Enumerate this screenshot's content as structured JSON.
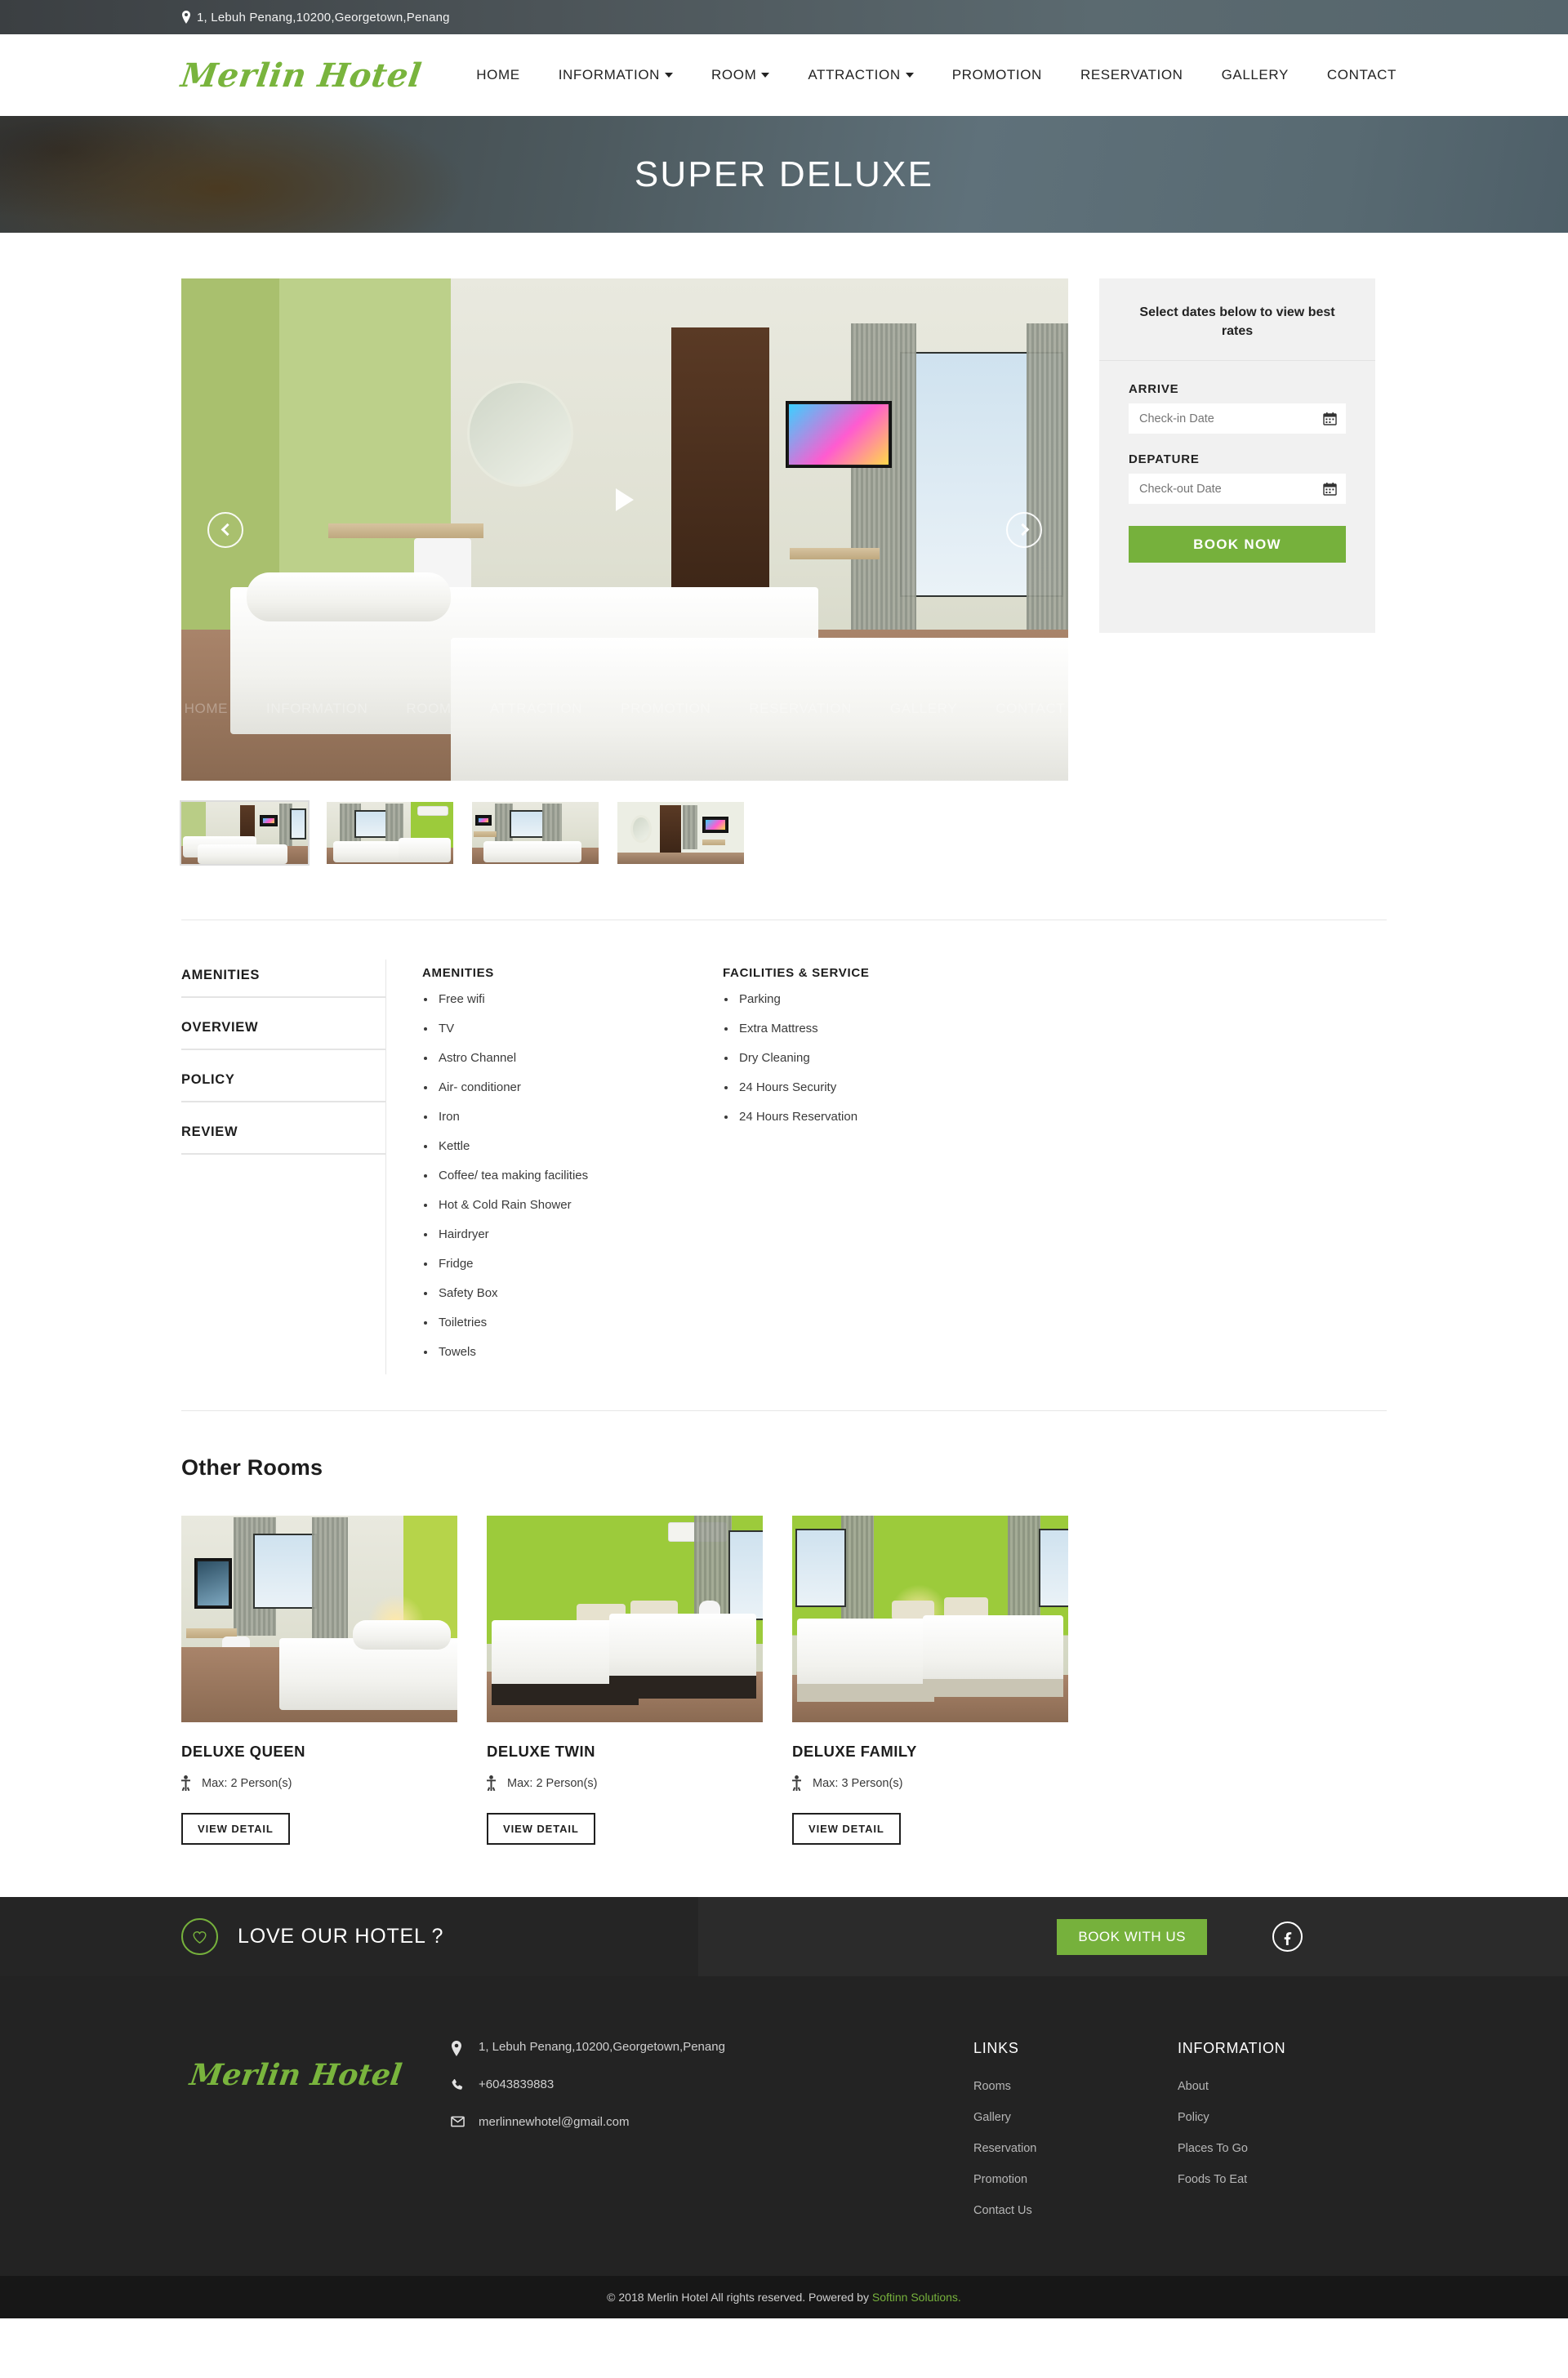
{
  "topbar": {
    "address": "1, Lebuh Penang,10200,Georgetown,Penang",
    "pin_icon": "map-pin-icon"
  },
  "brand": {
    "name": "Merlin Hotel"
  },
  "nav": {
    "items": [
      {
        "label": "HOME",
        "caret": false
      },
      {
        "label": "INFORMATION",
        "caret": true
      },
      {
        "label": "ROOM",
        "caret": true
      },
      {
        "label": "ATTRACTION",
        "caret": true
      },
      {
        "label": "PROMOTION",
        "caret": false
      },
      {
        "label": "RESERVATION",
        "caret": false
      },
      {
        "label": "GALLERY",
        "caret": false
      },
      {
        "label": "CONTACT",
        "caret": false
      }
    ]
  },
  "hero": {
    "title": "SUPER DELUXE"
  },
  "gallery": {
    "prev_label": "‹",
    "next_label": "›",
    "play_label": "play-video",
    "thumbs": [
      {
        "alt": "room-view-1"
      },
      {
        "alt": "room-view-2"
      },
      {
        "alt": "room-view-3"
      },
      {
        "alt": "room-view-4"
      }
    ]
  },
  "booking": {
    "heading": "Select dates below to view best rates",
    "arrive_label": "ARRIVE",
    "arrive_placeholder": "Check-in Date",
    "depart_label": "DEPATURE",
    "depart_placeholder": "Check-out Date",
    "arrive_value": "",
    "depart_value": "",
    "book_label": "BOOK NOW",
    "accent_color": "#76b13c",
    "calendar_icon": "calendar-icon"
  },
  "tabs": [
    {
      "label": "AMENITIES",
      "active": true
    },
    {
      "label": "OVERVIEW",
      "active": false
    },
    {
      "label": "POLICY",
      "active": false
    },
    {
      "label": "REVIEW",
      "active": false
    }
  ],
  "amenities": {
    "title": "AMENITIES",
    "items": [
      "Free wifi",
      "TV",
      "Astro Channel",
      "Air- conditioner",
      "Iron",
      "Kettle",
      "Coffee/ tea making facilities",
      "Hot & Cold Rain Shower",
      "Hairdryer",
      "Fridge",
      "Safety Box",
      "Toiletries",
      "Towels"
    ]
  },
  "facilities": {
    "title": "FACILITIES & SERVICE",
    "items": [
      "Parking",
      "Extra Mattress",
      "Dry Cleaning",
      "24 Hours Security",
      "24 Hours Reservation"
    ]
  },
  "other_rooms": {
    "title": "Other Rooms",
    "view_detail_label": "VIEW DETAIL",
    "person_icon": "person-icon",
    "cards": [
      {
        "name": "DELUXE QUEEN",
        "max": "Max: 2 Person(s)"
      },
      {
        "name": "DELUXE TWIN",
        "max": "Max: 2 Person(s)"
      },
      {
        "name": "DELUXE FAMILY",
        "max": "Max: 3 Person(s)"
      }
    ]
  },
  "cta": {
    "text": "LOVE OUR HOTEL ?",
    "heart_icon": "heart-icon",
    "button_label": "BOOK WITH US",
    "facebook_icon": "facebook-icon"
  },
  "footer": {
    "brand": "Merlin Hotel",
    "address": "1, Lebuh Penang,10200,Georgetown,Penang",
    "phone": "+6043839883",
    "email": "merlinnewhotel@gmail.com",
    "address_icon": "map-pin-icon",
    "phone_icon": "phone-icon",
    "email_icon": "envelope-icon",
    "links_title": "LINKS",
    "links": [
      "Rooms",
      "Gallery",
      "Reservation",
      "Promotion",
      "Contact Us"
    ],
    "information_title": "INFORMATION",
    "information": [
      "About",
      "Policy",
      "Places To Go",
      "Foods To Eat"
    ],
    "copyright_prefix": "© 2018 Merlin Hotel All rights reserved. Powered by ",
    "copyright_link": "Softinn Solutions."
  }
}
